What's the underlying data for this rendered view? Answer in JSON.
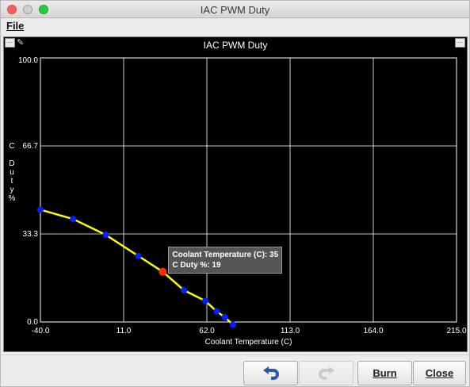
{
  "window": {
    "title": "IAC PWM Duty",
    "traffic_lights": [
      "#fc5f57",
      "#c8c8c8",
      "#28c940"
    ]
  },
  "menu": {
    "file_label": "File"
  },
  "panel": {
    "chart_title": "IAC PWM Duty",
    "left_button_label": "...",
    "right_button_label": "..."
  },
  "chart_data": {
    "type": "line",
    "title": "IAC PWM Duty",
    "xlabel": "Coolant Temperature (C)",
    "ylabel": "C Duty %",
    "xlim": [
      -40.0,
      215.0
    ],
    "ylim": [
      0.0,
      100.0
    ],
    "x_ticks": [
      "-40.0",
      "11.0",
      "62.0",
      "113.0",
      "164.0",
      "215.0"
    ],
    "y_ticks": [
      "0.0",
      "33.3",
      "66.7",
      "100.0"
    ],
    "series": [
      {
        "x": [
          -40,
          -20,
          0,
          20,
          35,
          48,
          61,
          68,
          73,
          78
        ],
        "y": [
          42.5,
          39,
          33,
          25,
          19,
          12,
          8,
          4,
          1.8,
          -1
        ]
      }
    ],
    "selected_index": 4,
    "line_color": "#ffff00",
    "point_color": "#0022ff",
    "selected_color": "#ff2a00",
    "grid": true
  },
  "tooltip": {
    "line1": "Coolant Temperature (C): 35",
    "line2": "C Duty %: 19"
  },
  "buttons": {
    "undo_icon": "undo-arrow-icon",
    "redo_icon": "redo-arrow-icon",
    "burn_label": "Burn",
    "close_label": "Close"
  }
}
